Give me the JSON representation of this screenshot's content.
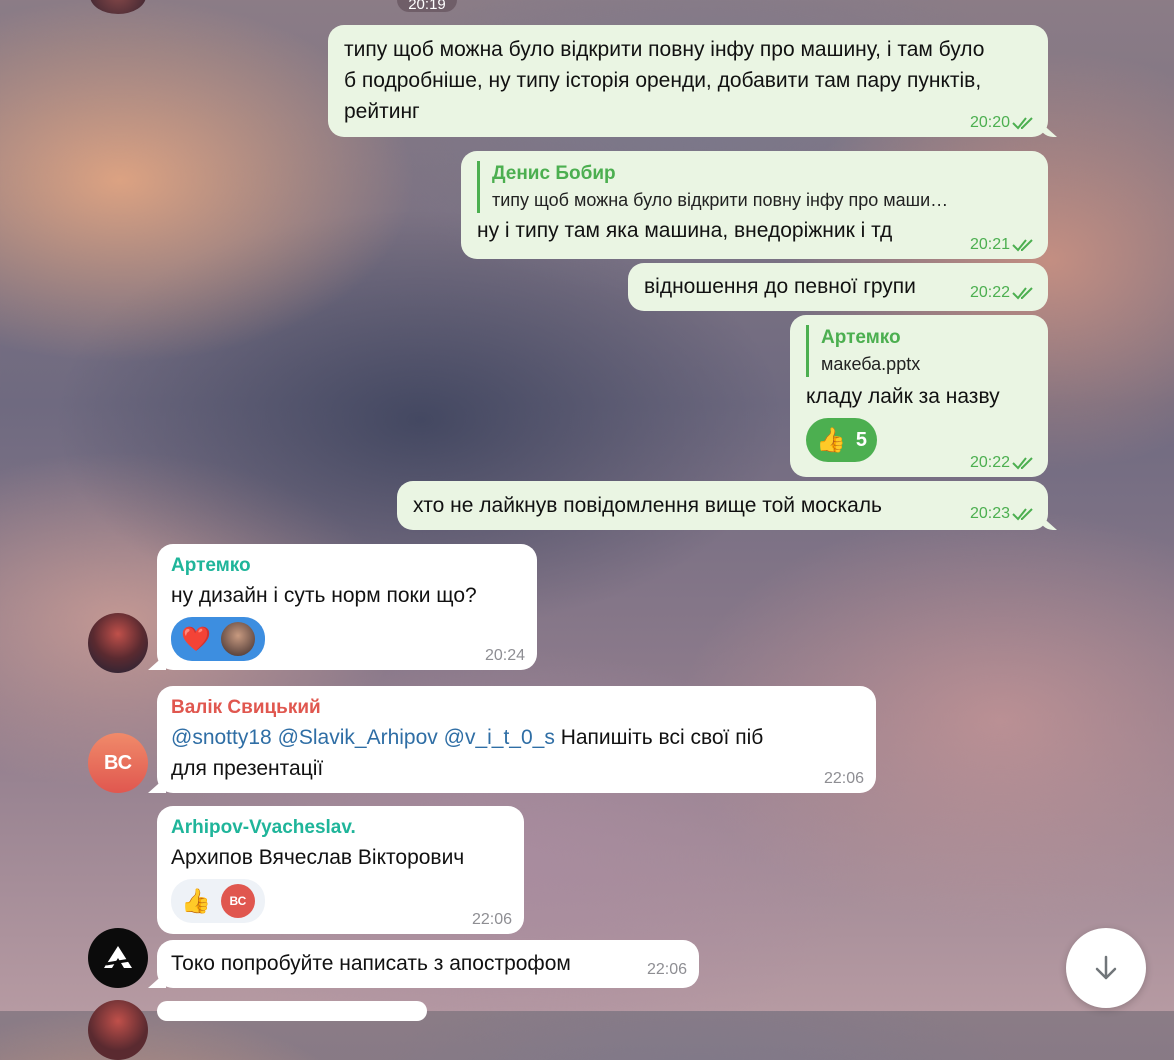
{
  "top": {
    "time": "20:19"
  },
  "messages": [
    {
      "id": "m1",
      "text": "типу щоб можна було відкрити повну інфу про машину, і там було б подробніше, ну типу історія оренди, добавити там пару пунктів, рейтинг",
      "time": "20:20"
    },
    {
      "id": "m2",
      "reply_name": "Денис Бобир",
      "reply_text": "типу щоб можна було відкрити повну інфу про маши…",
      "text": "ну і типу там яка машина, внедоріжник і тд",
      "time": "20:21"
    },
    {
      "id": "m3",
      "text": "відношення до певної групи",
      "time": "20:22"
    },
    {
      "id": "m4",
      "reply_name": "Артемко",
      "reply_text": "макеба.pptx",
      "text": "кладу лайк за назву",
      "reaction_emoji": "👍",
      "reaction_count": "5",
      "time": "20:22"
    },
    {
      "id": "m5",
      "text": "хто не лайкнув повідомлення вище той москаль",
      "time": "20:23"
    },
    {
      "id": "m6",
      "sender": "Артемко",
      "text": "ну дизайн і суть норм поки що?",
      "reaction_emoji": "❤️",
      "time": "20:24"
    },
    {
      "id": "m7",
      "sender": "Валік Свицький",
      "mentions": [
        "@snotty18",
        "@Slavik_Arhipov",
        "@v_i_t_0_s"
      ],
      "text": "Напишіть всі свої піб для презентації",
      "time": "22:06",
      "avatar_initials": "ВС"
    },
    {
      "id": "m8",
      "sender": "Arhipov-Vyacheslav.",
      "text": "Архипов Вячеслав Вікторович",
      "reaction_emoji": "👍",
      "reaction_avatar": "ВС",
      "time": "22:06"
    },
    {
      "id": "m9",
      "text": "Токо попробуйте написать з апострофом",
      "time": "22:06"
    }
  ],
  "colors": {
    "outgoing_bubble": "#eaf5e3",
    "incoming_bubble": "#ffffff",
    "accent_green": "#4caf50",
    "sender_artemko": "#1fb59a",
    "sender_valik": "#e0574f",
    "sender_arhipov": "#1fb59a",
    "mention": "#2f6ea5"
  },
  "icons": [
    "double-check-icon",
    "scroll-down-arrow-icon"
  ]
}
